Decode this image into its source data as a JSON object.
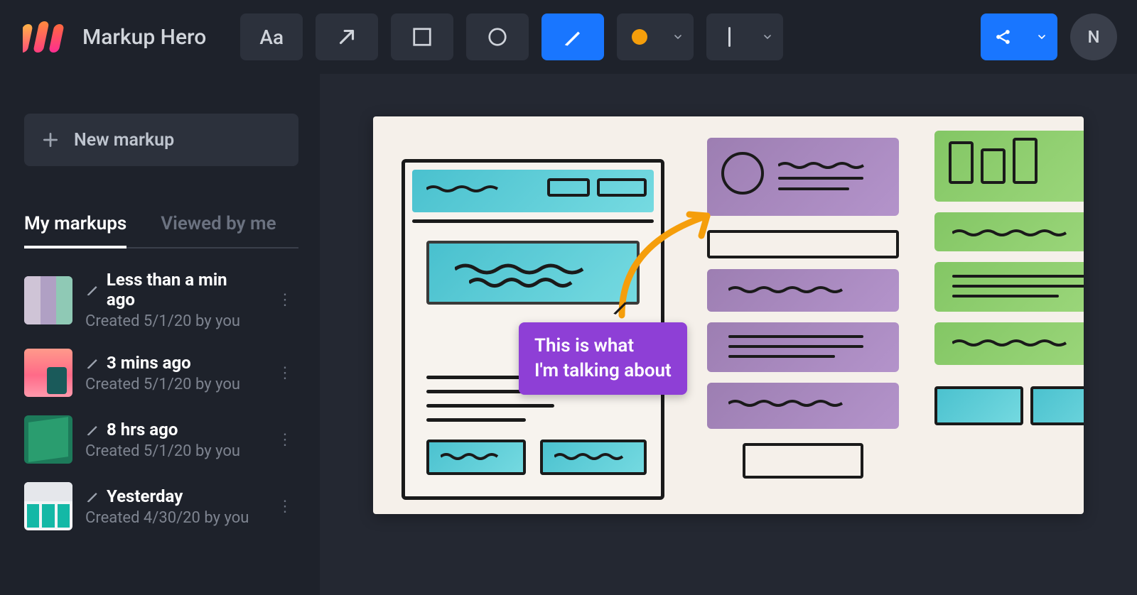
{
  "app": {
    "title": "Markup Hero"
  },
  "toolbar": {
    "tools": {
      "text": "Aa",
      "arrow": "arrow",
      "rect": "rect",
      "circle": "circle",
      "pen": "pen"
    },
    "color_swatch": "#f59e0b",
    "share_label": "Share"
  },
  "user": {
    "initial": "N"
  },
  "sidebar": {
    "new_markup_label": "New markup",
    "tabs": {
      "my_markups": "My markups",
      "viewed_by_me": "Viewed by me"
    },
    "items": [
      {
        "title": "Less than a min ago",
        "subtitle": "Created 5/1/20 by you"
      },
      {
        "title": "3 mins ago",
        "subtitle": "Created 5/1/20 by you"
      },
      {
        "title": "8 hrs ago",
        "subtitle": "Created 5/1/20 by you"
      },
      {
        "title": "Yesterday",
        "subtitle": "Created 4/30/20 by you"
      }
    ]
  },
  "annotation": {
    "line1": "This is what",
    "line2": "I'm talking about"
  }
}
